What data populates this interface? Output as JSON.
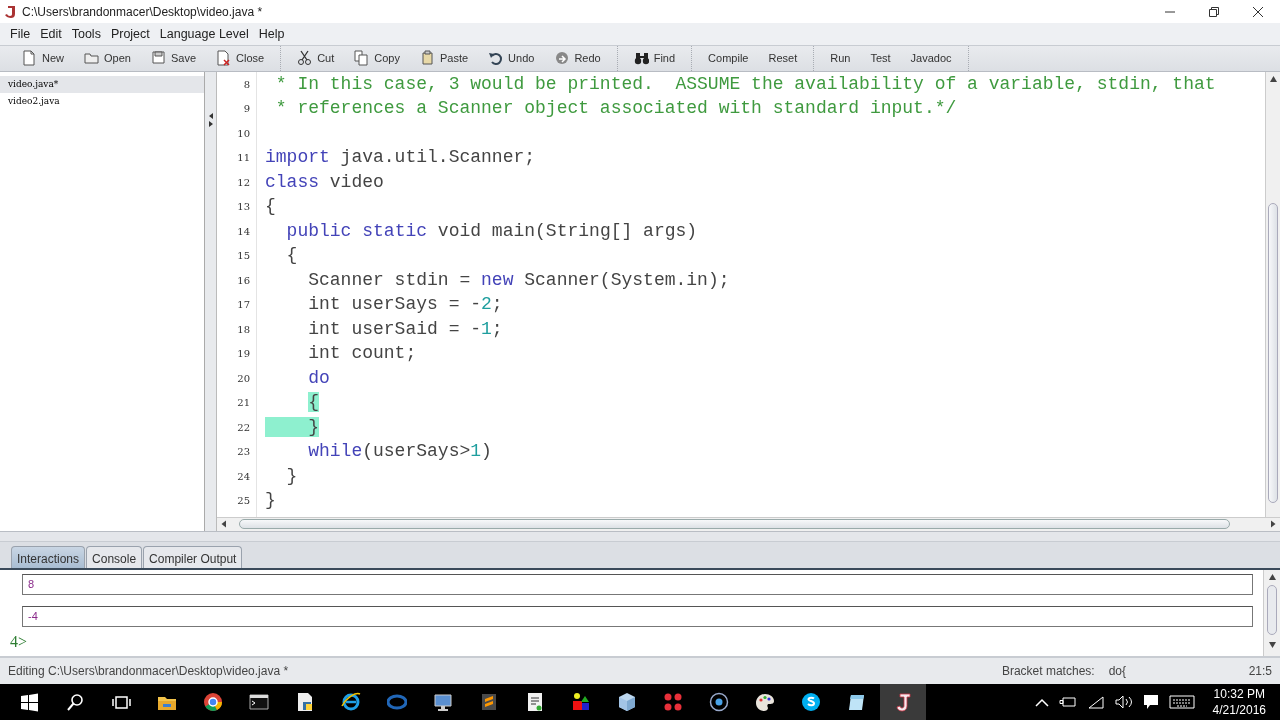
{
  "window": {
    "title": "C:\\Users\\brandonmacer\\Desktop\\video.java *"
  },
  "menu": [
    "File",
    "Edit",
    "Tools",
    "Project",
    "Language Level",
    "Help"
  ],
  "toolbar": [
    [
      {
        "kind": "new",
        "label": "New"
      },
      {
        "kind": "open",
        "label": "Open"
      },
      {
        "kind": "save",
        "label": "Save"
      },
      {
        "kind": "close",
        "label": "Close"
      }
    ],
    [
      {
        "kind": "cut",
        "label": "Cut"
      },
      {
        "kind": "copy",
        "label": "Copy"
      },
      {
        "kind": "paste",
        "label": "Paste"
      },
      {
        "kind": "undo",
        "label": "Undo"
      },
      {
        "kind": "redo",
        "label": "Redo"
      }
    ],
    [
      {
        "kind": "find",
        "label": "Find"
      }
    ],
    [
      {
        "kind": "text",
        "label": "Compile"
      },
      {
        "kind": "text",
        "label": "Reset"
      }
    ],
    [
      {
        "kind": "text",
        "label": "Run"
      },
      {
        "kind": "text",
        "label": "Test"
      },
      {
        "kind": "text",
        "label": "Javadoc"
      }
    ]
  ],
  "documents": [
    {
      "name": "video.java*",
      "selected": true
    },
    {
      "name": "video2.java",
      "selected": false
    }
  ],
  "editor": {
    "lines": [
      {
        "number": "8",
        "tokens": [
          {
            "kind": "comment",
            "text": " * In this case, 3 would be printed.  ASSUME the availability of a variable, stdin, that"
          }
        ]
      },
      {
        "number": "9",
        "tokens": [
          {
            "kind": "comment",
            "text": " * references a Scanner object associated with standard input.*/"
          }
        ]
      },
      {
        "number": "10"
      },
      {
        "number": "11",
        "tokens": [
          {
            "kind": "keyword",
            "text": "import"
          },
          {
            "kind": "plain",
            "text": " java.util.Scanner;"
          }
        ]
      },
      {
        "number": "12",
        "tokens": [
          {
            "kind": "keyword",
            "text": "class"
          },
          {
            "kind": "plain",
            "text": " video"
          }
        ]
      },
      {
        "number": "13",
        "tokens": [
          {
            "kind": "plain",
            "text": "{"
          }
        ]
      },
      {
        "number": "14",
        "tokens": [
          {
            "kind": "keyword",
            "text": "  public"
          },
          {
            "kind": "keyword",
            "text": " static"
          },
          {
            "kind": "plain",
            "text": " void main(String[] args)"
          }
        ]
      },
      {
        "number": "15",
        "tokens": [
          {
            "kind": "plain",
            "text": "  {"
          }
        ]
      },
      {
        "number": "16",
        "tokens": [
          {
            "kind": "plain",
            "text": "    Scanner stdin = "
          },
          {
            "kind": "keyword",
            "text": "new"
          },
          {
            "kind": "plain",
            "text": " Scanner(System.in);"
          }
        ]
      },
      {
        "number": "17",
        "tokens": [
          {
            "kind": "plain",
            "text": "    int userSays = -"
          },
          {
            "kind": "number",
            "text": "2"
          },
          {
            "kind": "plain",
            "text": ";"
          }
        ]
      },
      {
        "number": "18",
        "tokens": [
          {
            "kind": "plain",
            "text": "    int userSaid = -"
          },
          {
            "kind": "number",
            "text": "1"
          },
          {
            "kind": "plain",
            "text": ";"
          }
        ]
      },
      {
        "number": "19",
        "tokens": [
          {
            "kind": "plain",
            "text": "    int count;"
          }
        ]
      },
      {
        "number": "20",
        "tokens": [
          {
            "kind": "keyword",
            "text": "    do"
          }
        ]
      },
      {
        "number": "21",
        "tokens": [
          {
            "kind": "match_start",
            "text": "    {"
          }
        ]
      },
      {
        "number": "22",
        "tokens": [
          {
            "kind": "match",
            "text": "    }"
          }
        ]
      },
      {
        "number": "23",
        "tokens": [
          {
            "kind": "keyword",
            "text": "    while"
          },
          {
            "kind": "plain",
            "text": "(userSays>"
          },
          {
            "kind": "number",
            "text": "1"
          },
          {
            "kind": "plain",
            "text": ")"
          }
        ]
      },
      {
        "number": "24",
        "tokens": [
          {
            "kind": "plain",
            "text": "  }"
          }
        ]
      },
      {
        "number": "25",
        "tokens": [
          {
            "kind": "plain",
            "text": "}"
          }
        ]
      }
    ]
  },
  "tabs": [
    {
      "label": "Interactions",
      "selected": true
    },
    {
      "label": "Console",
      "selected": false
    },
    {
      "label": "Compiler Output",
      "selected": false
    }
  ],
  "interactions": {
    "outputs": [
      "8",
      "-4"
    ],
    "prompt": "4>"
  },
  "status_bar": {
    "file": "Editing C:\\Users\\brandonmacer\\Desktop\\video.java *",
    "bracket_label": "Bracket matches:",
    "bracket_value": "do{",
    "position": "21:5"
  },
  "taskbar": {
    "apps": [
      {
        "kind": "folder",
        "selected": false
      },
      {
        "kind": "chrome",
        "selected": false
      },
      {
        "kind": "terminal",
        "selected": false
      },
      {
        "kind": "document",
        "selected": false
      },
      {
        "kind": "ie",
        "selected": false
      },
      {
        "kind": "r",
        "selected": false
      },
      {
        "kind": "monitor",
        "selected": false
      },
      {
        "kind": "sublime",
        "selected": false
      },
      {
        "kind": "tex",
        "selected": false
      },
      {
        "kind": "shapes",
        "selected": false
      },
      {
        "kind": "cube",
        "selected": false
      },
      {
        "kind": "dots",
        "selected": false
      },
      {
        "kind": "ring",
        "selected": false
      },
      {
        "kind": "palette",
        "selected": false
      },
      {
        "kind": "skype",
        "selected": false
      },
      {
        "kind": "notepad",
        "selected": false
      },
      {
        "kind": "java",
        "selected": true
      }
    ],
    "time": "10:32 PM",
    "date": "4/21/2016"
  }
}
